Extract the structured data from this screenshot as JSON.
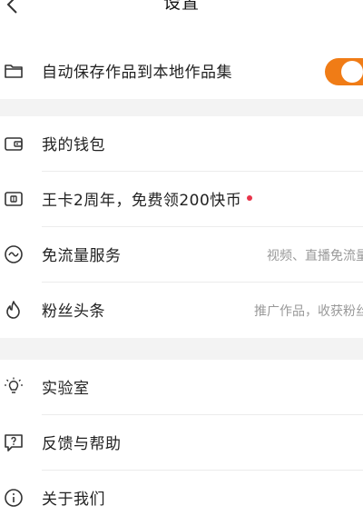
{
  "header": {
    "title": "设置"
  },
  "rows": {
    "autosave": {
      "label": "自动保存作品到本地作品集",
      "toggle_on": true
    },
    "wallet": {
      "label": "我的钱包"
    },
    "wangka": {
      "label": "王卡2周年，免费领200快币",
      "has_red_dot": true
    },
    "free_data": {
      "label": "免流量服务",
      "hint": "视频、直播免流量"
    },
    "fans_headline": {
      "label": "粉丝头条",
      "hint": "推广作品，收获粉丝"
    },
    "lab": {
      "label": "实验室"
    },
    "feedback": {
      "label": "反馈与帮助"
    },
    "about": {
      "label": "关于我们"
    }
  },
  "colors": {
    "accent": "#f07c16",
    "red_dot": "#e8344a",
    "section_gap": "#f3f3f3"
  }
}
